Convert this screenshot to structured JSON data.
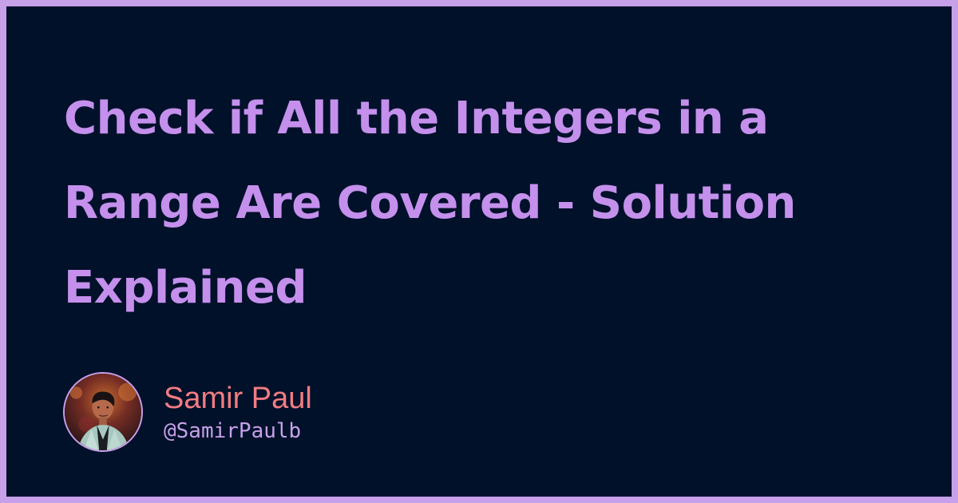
{
  "card": {
    "title": "Check if All the Integers in a Range Are Covered - Solution Explained",
    "author": {
      "name": "Samir Paul",
      "handle": "@SamirPaulb",
      "avatar_icon": "author-portrait"
    }
  },
  "colors": {
    "background": "#01112a",
    "border": "#c7a0ea",
    "title": "#c490ec",
    "author_name": "#f27c82",
    "author_handle": "#c7a0ea"
  }
}
